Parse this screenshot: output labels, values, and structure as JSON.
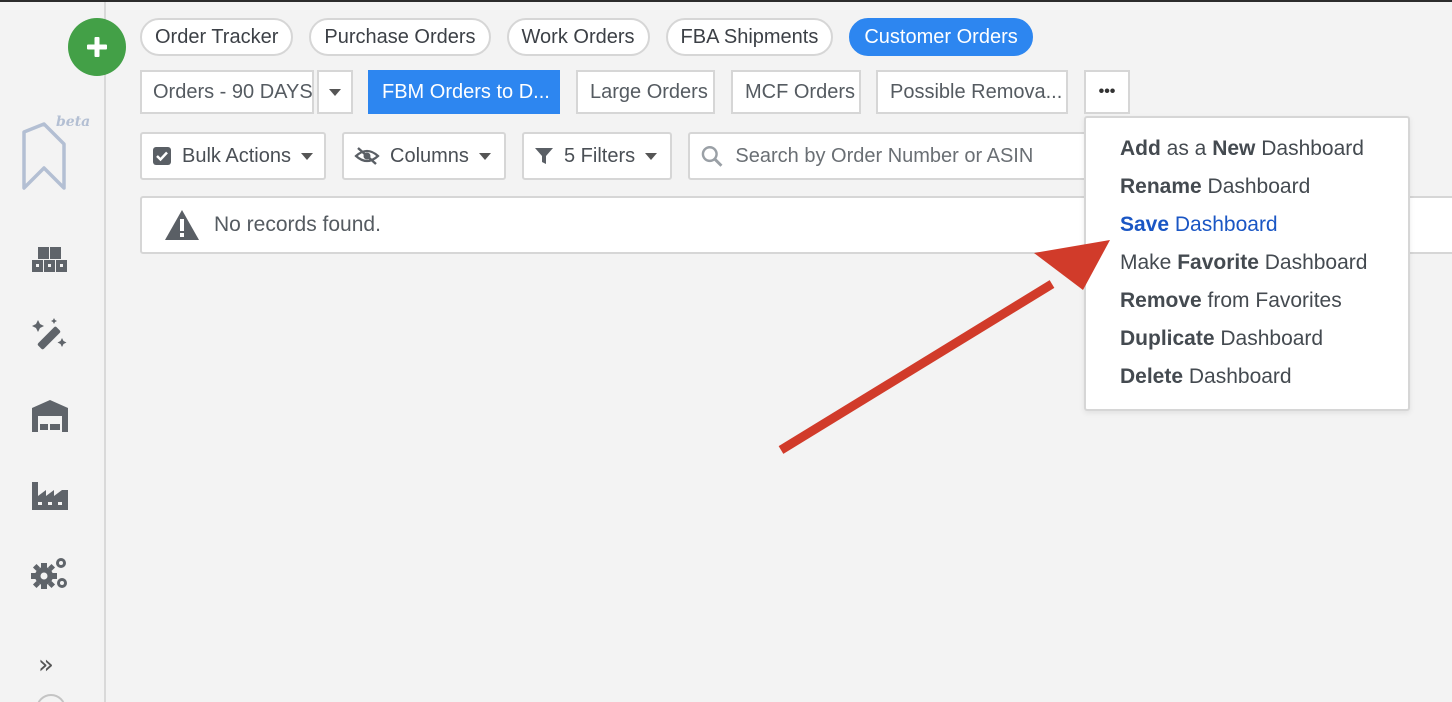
{
  "top_tabs": [
    "Order Tracker",
    "Purchase Orders",
    "Work Orders",
    "FBA Shipments",
    "Customer Orders"
  ],
  "active_tab": "Customer Orders",
  "dashboards": {
    "selected_view": "Orders - 90 DAYS",
    "items": [
      "FBM Orders to D...",
      "Large Orders",
      "MCF Orders",
      "Possible Remova..."
    ],
    "active": "FBM Orders to D...",
    "more_label": "•••"
  },
  "toolbar": {
    "bulk_actions": "Bulk Actions",
    "columns": "Columns",
    "filters": "5 Filters",
    "search_placeholder": "Search by Order Number or ASIN"
  },
  "alert": {
    "message": "No records found."
  },
  "menu": {
    "items": [
      {
        "parts": [
          [
            "Add",
            true
          ],
          [
            " as a ",
            false
          ],
          [
            "New",
            true
          ],
          [
            " Dashboard",
            false
          ]
        ]
      },
      {
        "parts": [
          [
            "Rename",
            true
          ],
          [
            " Dashboard",
            false
          ]
        ]
      },
      {
        "parts": [
          [
            "Save",
            true
          ],
          [
            " Dashboard",
            false
          ]
        ],
        "highlight": true
      },
      {
        "parts": [
          [
            "Make ",
            false
          ],
          [
            "Favorite",
            true
          ],
          [
            " Dashboard",
            false
          ]
        ]
      },
      {
        "parts": [
          [
            "Remove",
            true
          ],
          [
            " from Favorites",
            false
          ]
        ]
      },
      {
        "parts": [
          [
            "Duplicate",
            true
          ],
          [
            " Dashboard",
            false
          ]
        ]
      },
      {
        "parts": [
          [
            "Delete",
            true
          ],
          [
            " Dashboard",
            false
          ]
        ]
      }
    ]
  },
  "sidebar": {
    "logo_badge": "beta",
    "icons": [
      "inventory-icon",
      "magic-wand-icon",
      "warehouse-icon",
      "factory-icon",
      "settings-icon"
    ],
    "expand_label": "»"
  },
  "colors": {
    "accent": "#2d86f0",
    "add_button": "#43a047",
    "annotation_arrow": "#d13b2a",
    "highlight_text": "#1a56c4"
  }
}
